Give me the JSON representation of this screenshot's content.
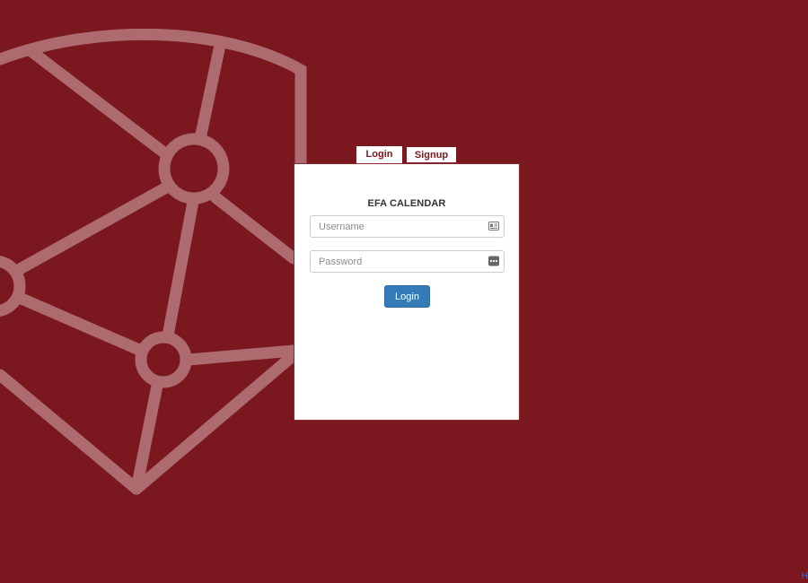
{
  "tabs": {
    "login_label": "Login",
    "signup_label": "Signup"
  },
  "panel": {
    "title": "EFA CALENDAR",
    "username": {
      "placeholder": "Username",
      "value": "",
      "icon": "id-card-icon"
    },
    "password": {
      "placeholder": "Password",
      "value": "",
      "icon": "ellipsis-icon"
    },
    "login_button_label": "Login"
  },
  "corner_text": "H",
  "colors": {
    "background": "#7a171f",
    "panel": "#ffffff",
    "accent": "#7a171f",
    "primary_button": "#337ab7",
    "background_art": "#ad6a6f"
  }
}
